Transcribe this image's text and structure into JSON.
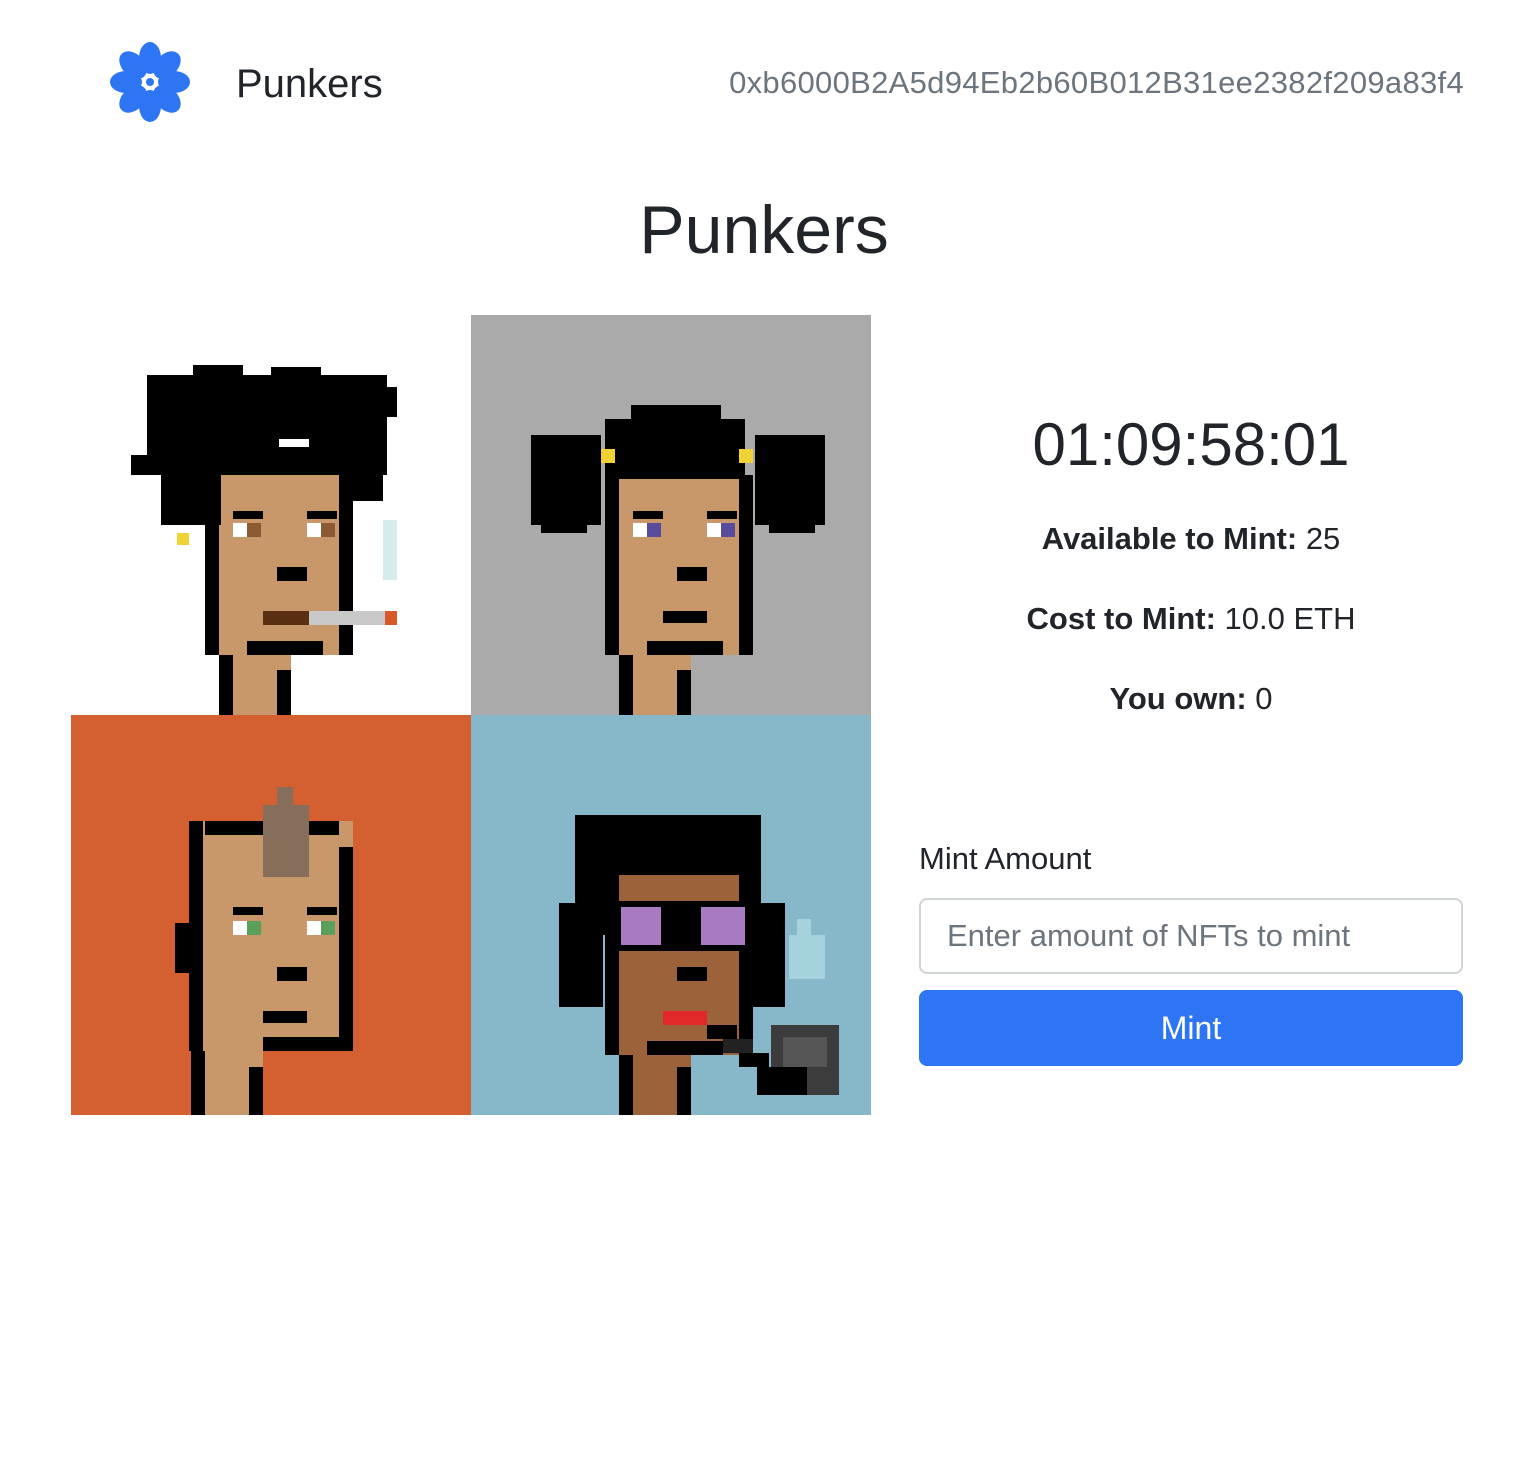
{
  "navbar": {
    "logo_icon": "flower-logo-icon",
    "brand": "Punkers",
    "wallet_address": "0xb6000B2A5d94Eb2b60B012B31ee2382f209a83f4"
  },
  "main": {
    "title": "Punkers",
    "countdown": "01:09:58:01",
    "stats": [
      {
        "label": "Available to Mint:",
        "value": "25"
      },
      {
        "label": "Cost to Mint:",
        "value": "10.0 ETH"
      },
      {
        "label": "You own:",
        "value": "0"
      }
    ],
    "form": {
      "label": "Mint Amount",
      "placeholder": "Enter amount of NFTs to mint",
      "value": "",
      "button": "Mint"
    }
  },
  "images": [
    {
      "name": "punk-messy-hair-cigarette",
      "background": "#ffffff"
    },
    {
      "name": "punk-pigtails",
      "background": "#aaaaaa"
    },
    {
      "name": "punk-mohawk",
      "background": "#d46032"
    },
    {
      "name": "punk-purple-glasses-pipe",
      "background": "#86b8ca"
    }
  ],
  "colors": {
    "accent": "#2d75f2",
    "text": "#212529",
    "muted": "#6c757d",
    "skin_light": "#c8976a",
    "skin_dark": "#9c6239"
  }
}
